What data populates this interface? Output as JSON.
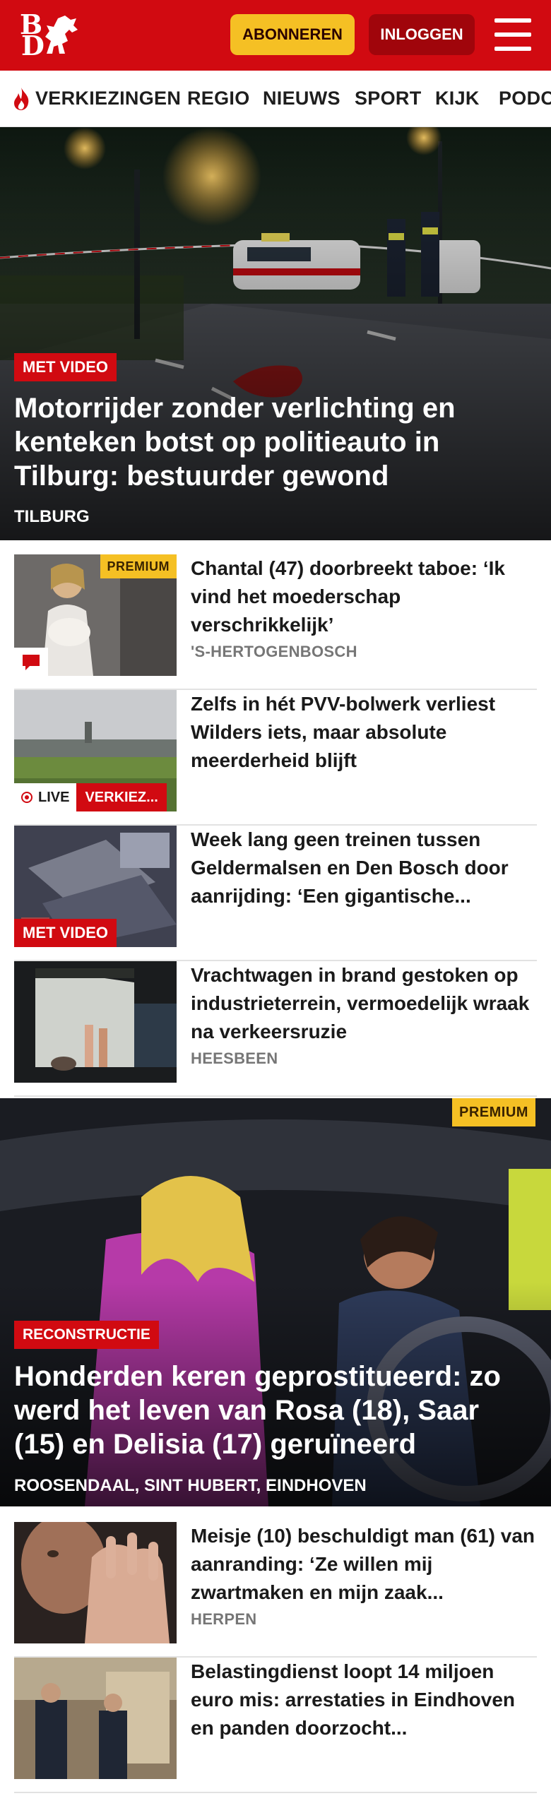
{
  "header": {
    "logo_top": "B",
    "logo_bottom": "D",
    "subscribe_label": "ABONNEREN",
    "login_label": "INLOGGEN"
  },
  "nav": {
    "items": [
      "VERKIEZINGEN",
      "REGIO",
      "NIEUWS",
      "SPORT",
      "KIJK",
      "PODC"
    ]
  },
  "hero": {
    "tag": "MET VIDEO",
    "title": "Motorrijder zonder verlichting en kenteken botst op politieauto in Tilburg: bestuurder gewond",
    "location": "TILBURG"
  },
  "articles": [
    {
      "title": "Chantal (47) doorbreekt taboe: ‘Ik vind het moederschap verschrikkelijk’",
      "location": "'S-HERTOGENBOSCH",
      "badge": "PREMIUM"
    },
    {
      "title": "Zelfs in hét PVV-bolwerk verliest Wilders iets, maar absolute meerderheid blijft",
      "live_label": "LIVE",
      "live_category": "VERKIEZ..."
    },
    {
      "title": "Week lang geen treinen tussen Geldermalsen en Den Bosch door aanrijding: ‘Een gigantische...",
      "tag": "MET VIDEO"
    },
    {
      "title": "Vrachtwagen in brand gestoken op industrieterrein, vermoedelijk wraak na verkeersruzie",
      "location": "HEESBEEN"
    }
  ],
  "feature": {
    "badge": "PREMIUM",
    "tag": "RECONSTRUCTIE",
    "title": "Honderden keren geprostitueerd: zo werd het leven van Rosa (18), Saar (15) en Delisia (17) geruïneerd",
    "location": "ROOSENDAAL, SINT HUBERT, EINDHOVEN"
  },
  "articles_bottom": [
    {
      "title": "Meisje (10) beschuldigt man (61) van aanranding: ‘Ze willen mij zwartmaken en mijn zaak...",
      "location": "HERPEN"
    },
    {
      "title": "Belastingdienst loopt 14 miljoen euro mis: arrestaties in Eindhoven en panden doorzocht..."
    }
  ],
  "colors": {
    "brand_red": "#d10a11",
    "premium_yellow": "#f5c024",
    "login_dark_red": "#a0050b"
  }
}
